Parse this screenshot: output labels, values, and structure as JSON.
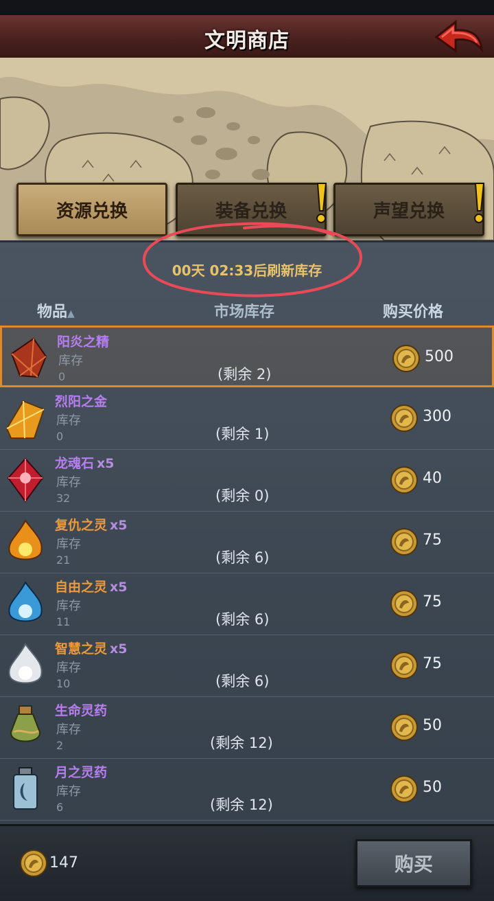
{
  "header": {
    "title": "文明商店"
  },
  "tabs": [
    {
      "label": "资源兑换",
      "active": true,
      "alert": false
    },
    {
      "label": "装备兑换",
      "active": false,
      "alert": true
    },
    {
      "label": "声望兑换",
      "active": false,
      "alert": true
    }
  ],
  "timer": "00天 02:33后刷新库存",
  "columns": {
    "item": "物品",
    "stock": "市场库存",
    "price": "购买价格"
  },
  "stock_label": "库存",
  "items": [
    {
      "name": "阳炎之精",
      "qty": "",
      "color": "#b77ef0",
      "stock": "0",
      "remain": "(剩余 2)",
      "price": "500",
      "icon": "flame-crystal-icon"
    },
    {
      "name": "烈阳之金",
      "qty": "",
      "color": "#b77ef0",
      "stock": "0",
      "remain": "(剩余 1)",
      "price": "300",
      "icon": "gold-crystal-icon"
    },
    {
      "name": "龙魂石",
      "qty": "x5",
      "color": "#b77ef0",
      "stock": "32",
      "remain": "(剩余 0)",
      "price": "40",
      "icon": "red-gem-icon"
    },
    {
      "name": "复仇之灵",
      "qty": "x5",
      "color": "#ef9a3a",
      "stock": "21",
      "remain": "(剩余 6)",
      "price": "75",
      "icon": "fire-spirit-icon"
    },
    {
      "name": "自由之灵",
      "qty": "x5",
      "color": "#ef9a3a",
      "stock": "11",
      "remain": "(剩余 6)",
      "price": "75",
      "icon": "blue-spirit-icon"
    },
    {
      "name": "智慧之灵",
      "qty": "x5",
      "color": "#ef9a3a",
      "stock": "10",
      "remain": "(剩余 6)",
      "price": "75",
      "icon": "white-spirit-icon"
    },
    {
      "name": "生命灵药",
      "qty": "",
      "color": "#b77ef0",
      "stock": "2",
      "remain": "(剩余 12)",
      "price": "50",
      "icon": "life-potion-icon"
    },
    {
      "name": "月之灵药",
      "qty": "",
      "color": "#b77ef0",
      "stock": "6",
      "remain": "(剩余 12)",
      "price": "50",
      "icon": "moon-potion-icon"
    }
  ],
  "footer": {
    "balance": "147",
    "buy_label": "购买"
  }
}
